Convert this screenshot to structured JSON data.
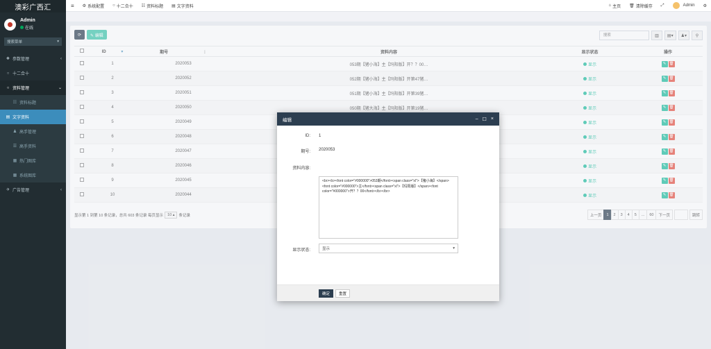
{
  "brand": {
    "title": "澳彩广西汇"
  },
  "user": {
    "name": "Admin",
    "status": "在线"
  },
  "sidebar": {
    "search_label": "搜索菜单",
    "items": [
      {
        "icon": "❖",
        "label": "参数管理",
        "arrow": "‹"
      },
      {
        "icon": "○",
        "label": "十二合十",
        "arrow": ""
      },
      {
        "icon": "○",
        "label": "资料管理",
        "arrow": "⌄"
      },
      {
        "icon": "☷",
        "label": "资料标题",
        "arrow": ""
      },
      {
        "icon": "▤",
        "label": "文字资料",
        "arrow": ""
      },
      {
        "icon": "♟",
        "label": "高手管理",
        "arrow": ""
      },
      {
        "icon": "☰",
        "label": "高手资料",
        "arrow": ""
      },
      {
        "icon": "▦",
        "label": "热门图库",
        "arrow": ""
      },
      {
        "icon": "▦",
        "label": "系统图库",
        "arrow": ""
      },
      {
        "icon": "✈",
        "label": "广告管理",
        "arrow": "‹"
      }
    ]
  },
  "topbar": {
    "menu_icon": "≡",
    "items": [
      {
        "icon": "⚙",
        "label": "系统配置"
      },
      {
        "icon": "○",
        "label": "十二合十"
      },
      {
        "icon": "☷",
        "label": "资料标题"
      },
      {
        "icon": "▤",
        "label": "文字资料"
      }
    ],
    "right": {
      "home": "主页",
      "clear": "清除缓存",
      "fullscreen": "⤢",
      "admin": "Admin",
      "settings": "⚙"
    }
  },
  "toolbar": {
    "refresh": "⟳",
    "edit_label": "✎ 编辑"
  },
  "search": {
    "placeholder": "搜索",
    "buttons": [
      "▥",
      "▤▾",
      "♟▾",
      "⚲"
    ]
  },
  "table": {
    "headers": [
      "",
      "ID",
      "期号",
      "资料内容",
      "显示状态",
      "操作"
    ],
    "sort_marks": [
      "",
      "▾",
      "⋮",
      "",
      "",
      ""
    ],
    "rows": [
      {
        "id": "1",
        "period": "2020053",
        "content": "053期【猪小海】主【玛阳版】开？？00…",
        "status": "显示"
      },
      {
        "id": "2",
        "period": "2020052",
        "content": "052期【猪小海】主【玛阳版】开第47猪…",
        "status": "显示"
      },
      {
        "id": "3",
        "period": "2020051",
        "content": "051期【猪小海】主【玛阳版】开第39猪…",
        "status": "显示"
      },
      {
        "id": "4",
        "period": "2020050",
        "content": "050期【猪大海】主【玛阳版】开第19猪…",
        "status": "显示"
      },
      {
        "id": "5",
        "period": "2020049",
        "content": "",
        "status": "显示"
      },
      {
        "id": "6",
        "period": "2020048",
        "content": "",
        "status": "显示"
      },
      {
        "id": "7",
        "period": "2020047",
        "content": "",
        "status": "显示"
      },
      {
        "id": "8",
        "period": "2020046",
        "content": "",
        "status": "显示"
      },
      {
        "id": "9",
        "period": "2020045",
        "content": "",
        "status": "显示"
      },
      {
        "id": "10",
        "period": "2020044",
        "content": "",
        "status": "显示"
      }
    ]
  },
  "pagination": {
    "info_prefix": "显示第 1 到第 10 条记录，总共 603 条记录 每页显示",
    "page_size": "10 ▴",
    "info_suffix": "条记录",
    "prev": "上一页",
    "pages": [
      "1",
      "2",
      "3",
      "4",
      "5",
      "...",
      "60"
    ],
    "next": "下一页",
    "jump": "跳转"
  },
  "modal": {
    "title": "编辑",
    "controls": [
      "–",
      "☐",
      "×"
    ],
    "fields": {
      "id_label": "ID:",
      "id_value": "1",
      "period_label": "期号:",
      "period_value": "2020053",
      "content_label": "资料内容:",
      "content_value": "<br><b><font color=\"#000000\">053期</font><span class=\"xl\">【猪小海】</span><font color=\"#000000\">主</font><span class=\"xl\">【玛阳版】</span><font color=\"#000000\">开？？00</font></b></br>",
      "status_label": "显示状态:",
      "status_value": "显示"
    },
    "submit": "确定",
    "reset": "重置"
  }
}
